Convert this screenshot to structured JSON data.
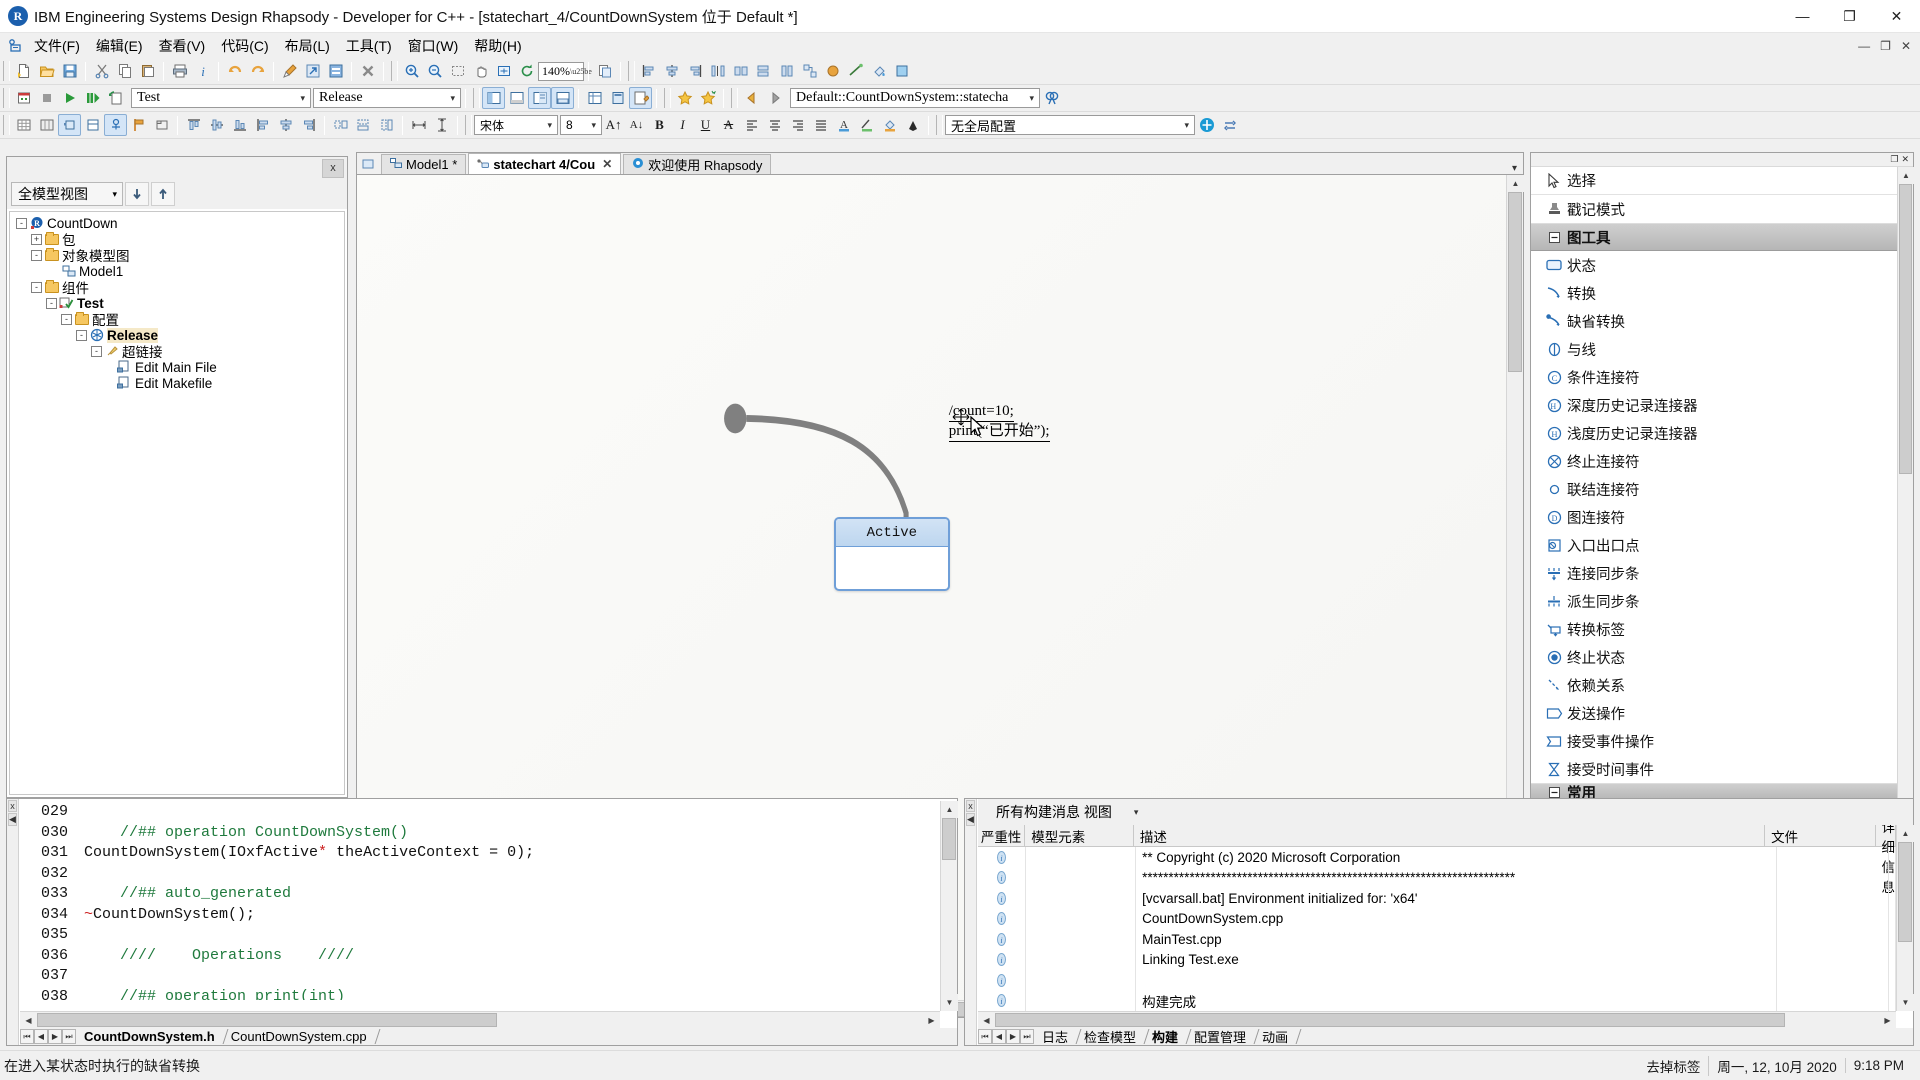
{
  "window": {
    "title": "IBM Engineering Systems Design Rhapsody - Developer for C++ - [statechart_4/CountDownSystem 位于 Default *]",
    "logo_letter": "R",
    "minimize": "—",
    "maximize": "❐",
    "close": "✕"
  },
  "menubar": {
    "items": [
      {
        "label": "文件(F)"
      },
      {
        "label": "编辑(E)"
      },
      {
        "label": "查看(V)"
      },
      {
        "label": "代码(C)"
      },
      {
        "label": "布局(L)"
      },
      {
        "label": "工具(T)"
      },
      {
        "label": "窗口(W)"
      },
      {
        "label": "帮助(H)"
      }
    ],
    "doc_minimize": "—",
    "doc_restore": "❐",
    "doc_close": "✕"
  },
  "toolbar_main": {
    "zoom_value": "140%",
    "buttons": [
      "new-icon",
      "open-icon",
      "save-icon",
      "cut-icon",
      "copy-icon",
      "paste-icon",
      "print-icon",
      "info-icon",
      "undo-icon",
      "redo-icon",
      "format-painter-icon",
      "make-icon",
      "generate-icon",
      "delete-icon"
    ],
    "zoom_buttons": [
      "zoom-in-icon",
      "zoom-out-icon",
      "zoom-region-icon",
      "pan-icon",
      "fit-icon",
      "refresh-icon"
    ],
    "right_buttons": [
      "copy-image-icon",
      "align-left-icon",
      "align-center-icon",
      "align-right-icon",
      "distribute-icon",
      "same-size-icon",
      "same-width-icon",
      "same-height-icon",
      "layout-icon",
      "color-icon",
      "line-icon",
      "fill-icon"
    ]
  },
  "toolbar_build": {
    "component_value": "Test",
    "configuration_value": "Release",
    "locator_value": "Default::CountDownSystem::statecha",
    "buttons": [
      "build-icon",
      "stop-icon",
      "run-icon",
      "build-run-icon",
      "roundtrip-icon"
    ],
    "view_buttons": [
      "browser-view-icon",
      "output-view-icon",
      "features-view-icon",
      "search-view-icon",
      "table-view-icon",
      "panel-view-icon",
      "edit-view-icon"
    ],
    "fav_buttons": [
      "add-favorite-icon",
      "manage-favorite-icon"
    ],
    "nav_buttons": [
      "back-icon",
      "forward-icon"
    ],
    "search_button": "find-icon"
  },
  "toolbar_format": {
    "font_value": "宋体",
    "size_value": "8",
    "config_value": "无全局配置",
    "layout_buttons": [
      "grid-icon",
      "snap-grid-icon",
      "ports-icon",
      "compartments-icon",
      "stereotype-icon",
      "flag-icon",
      "frame-icon"
    ],
    "align_buttons": [
      "align-top-icon",
      "align-middle-icon",
      "align-bottom-icon",
      "align-left2-icon",
      "align-center2-icon",
      "align-right2-icon"
    ],
    "size_buttons": [
      "same-size2-icon",
      "same-width2-icon",
      "same-height2-icon"
    ],
    "space_buttons": [
      "space-horizontal-icon",
      "space-vertical-icon"
    ],
    "text_buttons": [
      "grow-font-icon",
      "shrink-font-icon",
      "bold-icon",
      "italic-icon",
      "underline-icon",
      "strikethrough-icon",
      "text-left-icon",
      "text-center-icon",
      "text-right-icon",
      "text-justify-icon",
      "font-color-icon",
      "line-color-icon",
      "fill-color-icon",
      "brush-icon"
    ],
    "config_buttons": [
      "global-config-icon",
      "sync-icon"
    ]
  },
  "browser": {
    "close_label": "x",
    "view_selector": "全模型视图",
    "down_arrow": "↓",
    "up_arrow": "↑",
    "tree": [
      {
        "depth": 0,
        "expander": "-",
        "icon": "rhapsody-project-icon",
        "label": "CountDown",
        "bold": false,
        "selected": false
      },
      {
        "depth": 1,
        "expander": "+",
        "icon": "folder-icon",
        "label": "包",
        "bold": false,
        "selected": false
      },
      {
        "depth": 1,
        "expander": "-",
        "icon": "folder-icon",
        "label": "对象模型图",
        "bold": false,
        "selected": false
      },
      {
        "depth": 2,
        "expander": "",
        "icon": "object-model-diagram-icon",
        "label": "Model1",
        "bold": false,
        "selected": false
      },
      {
        "depth": 1,
        "expander": "-",
        "icon": "folder-icon",
        "label": "组件",
        "bold": false,
        "selected": false
      },
      {
        "depth": 2,
        "expander": "-",
        "icon": "component-icon",
        "label": "Test",
        "bold": true,
        "selected": false
      },
      {
        "depth": 3,
        "expander": "-",
        "icon": "folder-icon",
        "label": "配置",
        "bold": false,
        "selected": false
      },
      {
        "depth": 4,
        "expander": "-",
        "icon": "configuration-icon",
        "label": "Release",
        "bold": true,
        "selected": true
      },
      {
        "depth": 5,
        "expander": "-",
        "icon": "hyperlink-icon",
        "label": "超链接",
        "bold": false,
        "selected": false
      },
      {
        "depth": 6,
        "expander": "",
        "icon": "file-edit-icon",
        "label": "Edit Main File",
        "bold": false,
        "selected": false
      },
      {
        "depth": 6,
        "expander": "",
        "icon": "file-edit-icon",
        "label": "Edit Makefile",
        "bold": false,
        "selected": false
      }
    ]
  },
  "editor": {
    "tabs": [
      {
        "label": "Model1 *",
        "icon": "diagram-tab-icon",
        "active": false,
        "closable": false
      },
      {
        "label": "statechart 4/Cou",
        "icon": "statechart-tab-icon",
        "active": true,
        "closable": true
      },
      {
        "label": "欢迎使用 Rhapsody",
        "icon": "welcome-tab-icon",
        "active": false,
        "closable": false
      }
    ],
    "close_x": "✕",
    "collapse": "▾",
    "diagram": {
      "transition_label_line1": "/count=10;",
      "transition_label_line2": "print(“已开始”);",
      "state_name": "Active"
    }
  },
  "palette": {
    "restore_icon": "❐",
    "close_icon": "✕",
    "items": [
      {
        "label": "选择",
        "icon": "cursor-icon",
        "type": "tool"
      },
      {
        "label": "戳记模式",
        "icon": "stamp-icon",
        "type": "tool"
      },
      {
        "label": "图工具",
        "icon": "collapse-box-icon",
        "type": "header"
      },
      {
        "label": "状态",
        "icon": "state-icon",
        "type": "tool"
      },
      {
        "label": "转换",
        "icon": "transition-icon",
        "type": "tool"
      },
      {
        "label": "缺省转换",
        "icon": "default-transition-icon",
        "type": "tool"
      },
      {
        "label": "与线",
        "icon": "and-line-icon",
        "type": "tool"
      },
      {
        "label": "条件连接符",
        "icon": "condition-connector-icon",
        "type": "tool"
      },
      {
        "label": "深度历史记录连接器",
        "icon": "deep-history-icon",
        "type": "tool"
      },
      {
        "label": "浅度历史记录连接器",
        "icon": "shallow-history-icon",
        "type": "tool"
      },
      {
        "label": "终止连接符",
        "icon": "termination-connector-icon",
        "type": "tool"
      },
      {
        "label": "联结连接符",
        "icon": "junction-connector-icon",
        "type": "tool"
      },
      {
        "label": "图连接符",
        "icon": "diagram-connector-icon",
        "type": "tool"
      },
      {
        "label": "入口出口点",
        "icon": "entry-exit-point-icon",
        "type": "tool"
      },
      {
        "label": "连接同步条",
        "icon": "join-sync-bar-icon",
        "type": "tool"
      },
      {
        "label": "派生同步条",
        "icon": "fork-sync-bar-icon",
        "type": "tool"
      },
      {
        "label": "转换标签",
        "icon": "transition-label-icon",
        "type": "tool"
      },
      {
        "label": "终止状态",
        "icon": "termination-state-icon",
        "type": "tool"
      },
      {
        "label": "依赖关系",
        "icon": "dependency-icon",
        "type": "tool"
      },
      {
        "label": "发送操作",
        "icon": "send-action-icon",
        "type": "tool"
      },
      {
        "label": "接受事件操作",
        "icon": "accept-event-action-icon",
        "type": "tool"
      },
      {
        "label": "接受时间事件",
        "icon": "accept-time-event-icon",
        "type": "tool"
      },
      {
        "label": "常用",
        "icon": "common-icon",
        "type": "header"
      }
    ]
  },
  "code_editor": {
    "lines": [
      {
        "no": "029",
        "segments": []
      },
      {
        "no": "030",
        "segments": [
          {
            "t": "    ",
            "c": "ct"
          },
          {
            "t": "//## operation CountDownSystem()",
            "c": "cm"
          }
        ]
      },
      {
        "no": "031",
        "segments": [
          {
            "t": "CountDownSystem(IOxfActive",
            "c": "ct"
          },
          {
            "t": "*",
            "c": "cr"
          },
          {
            "t": " theActiveContext = 0);",
            "c": "ct"
          }
        ]
      },
      {
        "no": "032",
        "segments": []
      },
      {
        "no": "033",
        "segments": [
          {
            "t": "    ",
            "c": "ct"
          },
          {
            "t": "//## auto_generated",
            "c": "cm"
          }
        ]
      },
      {
        "no": "034",
        "segments": [
          {
            "t": "~",
            "c": "cr"
          },
          {
            "t": "CountDownSystem();",
            "c": "ct"
          }
        ]
      },
      {
        "no": "035",
        "segments": []
      },
      {
        "no": "036",
        "segments": [
          {
            "t": "    ",
            "c": "ct"
          },
          {
            "t": "////    Operations    ////",
            "c": "cm"
          }
        ]
      },
      {
        "no": "037",
        "segments": []
      },
      {
        "no": "038",
        "segments": [
          {
            "t": "    ",
            "c": "ct"
          },
          {
            "t": "//## operation print(int)",
            "c": "cm"
          }
        ]
      }
    ],
    "tabs": [
      {
        "label": "CountDownSystem.h",
        "active": true
      },
      {
        "label": "CountDownSystem.cpp",
        "active": false
      }
    ],
    "nav": [
      "⏮",
      "◀",
      "▶",
      "⏭"
    ]
  },
  "output": {
    "view_selector": "所有构建消息 视图",
    "columns": [
      {
        "label": "严重性",
        "key": "severity"
      },
      {
        "label": "模型元素",
        "key": "element"
      },
      {
        "label": "描述",
        "key": "description"
      },
      {
        "label": "文件",
        "key": "file"
      },
      {
        "label": "更多详细信息",
        "key": "more"
      }
    ],
    "rows": [
      {
        "severity": "info",
        "element": "",
        "description": "** Copyright (c) 2020 Microsoft Corporation",
        "file": "",
        "more": ""
      },
      {
        "severity": "info",
        "element": "",
        "description": "***********************************************************************",
        "file": "",
        "more": ""
      },
      {
        "severity": "info",
        "element": "",
        "description": "[vcvarsall.bat] Environment initialized for: 'x64'",
        "file": "",
        "more": ""
      },
      {
        "severity": "info",
        "element": "",
        "description": "CountDownSystem.cpp",
        "file": "",
        "more": ""
      },
      {
        "severity": "info",
        "element": "",
        "description": "MainTest.cpp",
        "file": "",
        "more": ""
      },
      {
        "severity": "info",
        "element": "",
        "description": "Linking Test.exe",
        "file": "",
        "more": ""
      },
      {
        "severity": "info",
        "element": "",
        "description": "",
        "file": "",
        "more": ""
      },
      {
        "severity": "info",
        "element": "",
        "description": "构建完成",
        "file": "",
        "more": ""
      }
    ],
    "tabs": [
      {
        "label": "日志",
        "active": false
      },
      {
        "label": "检查模型",
        "active": false
      },
      {
        "label": "构建",
        "active": true
      },
      {
        "label": "配置管理",
        "active": false
      },
      {
        "label": "动画",
        "active": false
      }
    ],
    "nav": [
      "⏮",
      "◀",
      "▶",
      "⏭"
    ]
  },
  "statusbar": {
    "hint": "在进入某状态时执行的缺省转换",
    "tag": "去掉标签",
    "date": "周一, 12, 10月 2020",
    "time": "9:18 PM"
  }
}
